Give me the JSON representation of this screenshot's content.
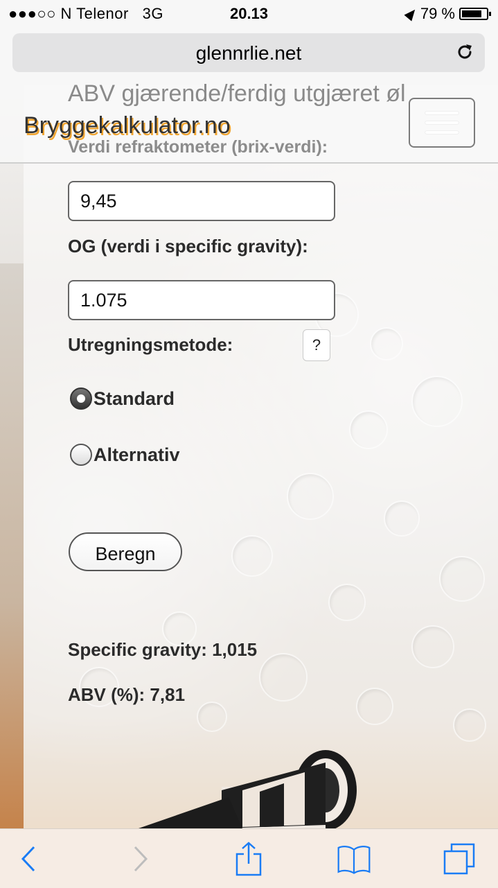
{
  "status_bar": {
    "carrier": "●●●○○ N Telenor",
    "network": "3G",
    "time": "20.13",
    "battery_text": "79 %",
    "battery_level": 0.79
  },
  "browser": {
    "url": "glennrlie.net"
  },
  "page": {
    "ghost_heading": "ABV gjærende/ferdig utgjæret øl",
    "brand": "Bryggekalkulator.no",
    "ghost_subheading": "Verdi refraktometer (brix-verdi):",
    "brix_value": "9,45",
    "og_label": "OG (verdi i specific gravity):",
    "og_value": "1.075",
    "method_label": "Utregningsmetode:",
    "help_label": "?",
    "options": [
      {
        "label": "Standard",
        "checked": true
      },
      {
        "label": "Alternativ",
        "checked": false
      }
    ],
    "submit_label": "Beregn",
    "result_sg": "Specific gravity: 1,015",
    "result_abv": "ABV (%): 7,81"
  },
  "toolbar": {
    "icons": [
      "back-icon",
      "forward-icon",
      "share-icon",
      "bookmarks-icon",
      "tabs-icon"
    ]
  },
  "colors": {
    "brand_shadow": "#f0a531",
    "ios_blue": "#1a7cf5"
  }
}
